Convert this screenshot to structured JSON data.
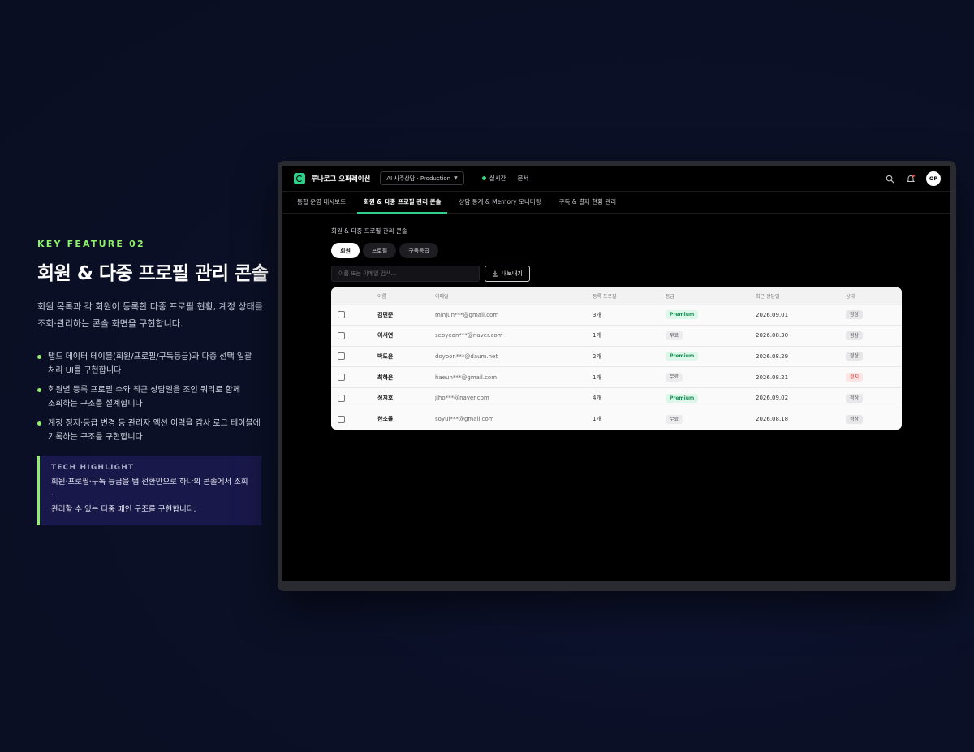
{
  "intro": {
    "eyebrow": "KEY FEATURE 02",
    "title": "회원 & 다중 프로필 관리 콘솔",
    "desc_line1": "회원 목록과 각 회원이 등록한 다중 프로필 현황, 계정 상태를",
    "desc_line2": "조회·관리하는 콘솔 화면을 구현합니다.",
    "bullets": [
      {
        "l1": "탭드 데이터 테이블(회원/프로필/구독등급)과 다중 선택 일괄",
        "l2": "처리 UI를 구현합니다"
      },
      {
        "l1": "회원별 등록 프로필 수와 최근 상담일을 조인 쿼리로 함께",
        "l2": "조회하는 구조를 설계합니다"
      },
      {
        "l1": "계정 정지·등급 변경 등 관리자 액션 이력을 감사 로그 테이블에",
        "l2": "기록하는 구조를 구현합니다"
      }
    ],
    "tech_title": "TECH HIGHLIGHT",
    "tech_l1": "회원·프로필·구독 등급을 탭 전환만으로 하나의 콘솔에서 조회·",
    "tech_l2": "관리할 수 있는 다중 패인 구조를 구현합니다."
  },
  "app": {
    "brand": "루나로그 오퍼레이션",
    "env": "AI 사주상담 · Production",
    "live": "실시간",
    "docs": "문서",
    "avatar": "OP",
    "nav": [
      "통합 운영 대시보드",
      "회원 & 다중 프로필 관리 콘솔",
      "상담 통계 & Memory 모니터링",
      "구독 & 결제 현황 관리"
    ],
    "section_title": "회원 & 다중 프로필 관리 콘솔",
    "pills": [
      "회원",
      "프로필",
      "구독등급"
    ],
    "search_placeholder": "이름 또는 이메일 검색...",
    "export": "내보내기",
    "columns": [
      "이름",
      "이메일",
      "등록 프로필",
      "등급",
      "최근 상담일",
      "상태"
    ],
    "rows": [
      {
        "name": "김민준",
        "email": "minjun***@gmail.com",
        "profiles": "3개",
        "grade": "Premium",
        "last": "2026.09.01",
        "status": "정상"
      },
      {
        "name": "이서연",
        "email": "seoyeon***@naver.com",
        "profiles": "1개",
        "grade": "무료",
        "last": "2026.08.30",
        "status": "정상"
      },
      {
        "name": "박도윤",
        "email": "doyoon***@daum.net",
        "profiles": "2개",
        "grade": "Premium",
        "last": "2026.08.29",
        "status": "정상"
      },
      {
        "name": "최하은",
        "email": "haeun***@gmail.com",
        "profiles": "1개",
        "grade": "무료",
        "last": "2026.08.21",
        "status": "정지"
      },
      {
        "name": "정지호",
        "email": "jiho***@naver.com",
        "profiles": "4개",
        "grade": "Premium",
        "last": "2026.09.02",
        "status": "정상"
      },
      {
        "name": "한소율",
        "email": "soyul***@gmail.com",
        "profiles": "1개",
        "grade": "무료",
        "last": "2026.08.18",
        "status": "정상"
      }
    ]
  },
  "colors": {
    "accent_green": "#8ff06a",
    "brand_green": "#2fd08a",
    "premium": "#169153",
    "stopped": "#d23b3b"
  }
}
